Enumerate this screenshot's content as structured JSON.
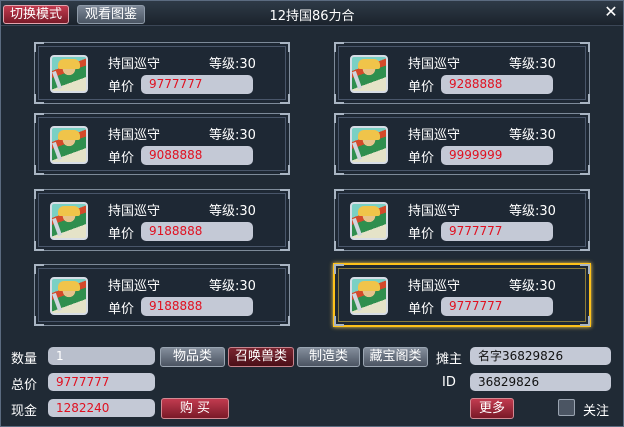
{
  "header": {
    "mode_button": "切换模式",
    "album_button": "观看图鉴",
    "title": "12持国86力合",
    "close": "✕"
  },
  "cards": [
    {
      "name": "持国巡守",
      "level": "等级:30",
      "price_label": "单价",
      "price": "9777777",
      "selected": false
    },
    {
      "name": "持国巡守",
      "level": "等级:30",
      "price_label": "单价",
      "price": "9288888",
      "selected": false
    },
    {
      "name": "持国巡守",
      "level": "等级:30",
      "price_label": "单价",
      "price": "9088888",
      "selected": false
    },
    {
      "name": "持国巡守",
      "level": "等级:30",
      "price_label": "单价",
      "price": "9999999",
      "selected": false
    },
    {
      "name": "持国巡守",
      "level": "等级:30",
      "price_label": "单价",
      "price": "9188888",
      "selected": false
    },
    {
      "name": "持国巡守",
      "level": "等级:30",
      "price_label": "单价",
      "price": "9777777",
      "selected": false
    },
    {
      "name": "持国巡守",
      "level": "等级:30",
      "price_label": "单价",
      "price": "9188888",
      "selected": false
    },
    {
      "name": "持国巡守",
      "level": "等级:30",
      "price_label": "单价",
      "price": "9777777",
      "selected": true
    }
  ],
  "bottom": {
    "quantity_label": "数量",
    "quantity_value": "1",
    "total_label": "总价",
    "total_value": "9777777",
    "cash_label": "现金",
    "cash_value": "1282240",
    "buy_button": "购 买",
    "categories": [
      "物品类",
      "召唤兽类",
      "制造类",
      "藏宝阁类"
    ],
    "active_category": 1,
    "owner_label": "摊主",
    "owner_value": "名字36829826",
    "id_label": "ID",
    "id_value": "36829826",
    "more_button": "更多",
    "follow_label": "关注"
  },
  "colors": {
    "price_text": "#e01020",
    "selected_border": "#ffc21a",
    "accent_button": "#c23b4f"
  }
}
